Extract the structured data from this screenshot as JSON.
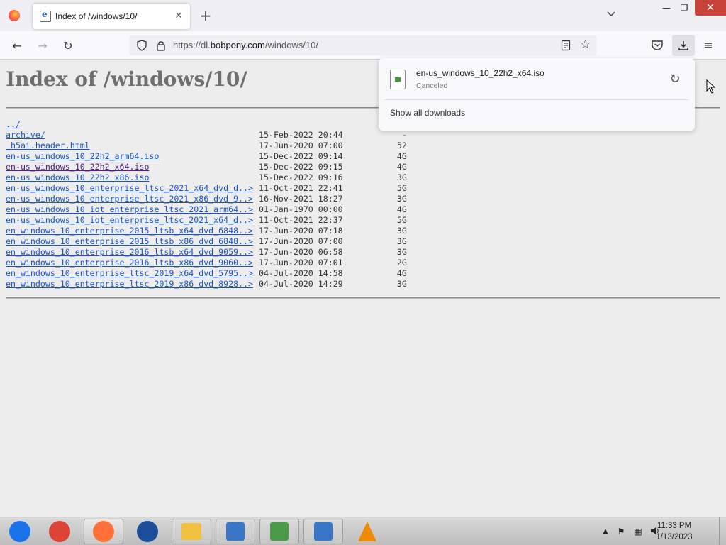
{
  "browser": {
    "tab": {
      "title": "Index of /windows/10/",
      "close": "✕"
    },
    "new_tab": "+",
    "list_tabs": "⌄",
    "window": {
      "minimize": "—",
      "restore": "❐",
      "close": "✕"
    },
    "nav": {
      "back": "←",
      "forward": "→",
      "reload": "↻"
    },
    "url": {
      "scheme": "https://dl.",
      "host": "bobpony.com",
      "path": "/windows/10/"
    },
    "star": "☆",
    "menu": "≡"
  },
  "page": {
    "heading": "Index of /windows/10/",
    "listing": [
      {
        "name": "../",
        "date": "",
        "size": "",
        "visited": false
      },
      {
        "name": "archive/",
        "date": "15-Feb-2022 20:44",
        "size": "      -",
        "visited": false
      },
      {
        "name": "_h5ai.header.html",
        "date": "17-Jun-2020 07:00",
        "size": "     52",
        "visited": false
      },
      {
        "name": "en-us_windows_10_22h2_arm64.iso",
        "date": "15-Dec-2022 09:14",
        "size": "     4G",
        "visited": false
      },
      {
        "name": "en-us_windows_10_22h2_x64.iso",
        "date": "15-Dec-2022 09:15",
        "size": "     4G",
        "visited": true
      },
      {
        "name": "en-us_windows_10_22h2_x86.iso",
        "date": "15-Dec-2022 09:16",
        "size": "     3G",
        "visited": false
      },
      {
        "name": "en-us_windows_10_enterprise_ltsc_2021_x64_dvd_d..>",
        "date": "11-Oct-2021 22:41",
        "size": "     5G",
        "visited": false
      },
      {
        "name": "en-us_windows_10_enterprise_ltsc_2021_x86_dvd_9..>",
        "date": "16-Nov-2021 18:27",
        "size": "     3G",
        "visited": false
      },
      {
        "name": "en-us_windows_10_iot_enterprise_ltsc_2021_arm64..>",
        "date": "01-Jan-1970 00:00",
        "size": "     4G",
        "visited": false
      },
      {
        "name": "en-us_windows_10_iot_enterprise_ltsc_2021_x64_d..>",
        "date": "11-Oct-2021 22:37",
        "size": "     5G",
        "visited": false
      },
      {
        "name": "en_windows_10_enterprise_2015_ltsb_x64_dvd_6848..>",
        "date": "17-Jun-2020 07:18",
        "size": "     3G",
        "visited": false
      },
      {
        "name": "en_windows_10_enterprise_2015_ltsb_x86_dvd_6848..>",
        "date": "17-Jun-2020 07:00",
        "size": "     3G",
        "visited": false
      },
      {
        "name": "en_windows_10_enterprise_2016_ltsb_x64_dvd_9059..>",
        "date": "17-Jun-2020 06:58",
        "size": "     3G",
        "visited": false
      },
      {
        "name": "en_windows_10_enterprise_2016_ltsb_x86_dvd_9060..>",
        "date": "17-Jun-2020 07:01",
        "size": "     2G",
        "visited": false
      },
      {
        "name": "en_windows_10_enterprise_ltsc_2019_x64_dvd_5795..>",
        "date": "04-Jul-2020 14:58",
        "size": "     4G",
        "visited": false
      },
      {
        "name": "en_windows_10_enterprise_ltsc_2019_x86_dvd_8928..>",
        "date": "04-Jul-2020 14:29",
        "size": "     3G",
        "visited": false
      }
    ]
  },
  "downloads_panel": {
    "item": {
      "filename": "en-us_windows_10_22h2_x64.iso",
      "status": "Canceled",
      "retry": "↻"
    },
    "show_all": "Show all downloads"
  },
  "taskbar": {
    "apps": [
      {
        "name": "chrome-os-like-icon",
        "color": "#1a73e8"
      },
      {
        "name": "chrome-icon",
        "color": "#db4437"
      },
      {
        "name": "firefox-icon",
        "color": "#ff7139"
      },
      {
        "name": "opera-like-icon",
        "color": "#1d4e9c"
      },
      {
        "name": "file-explorer-icon",
        "color": "#f0c040"
      },
      {
        "name": "network-computer-icon",
        "color": "#3a76c8"
      },
      {
        "name": "users-icon",
        "color": "#4a9a4a"
      },
      {
        "name": "remote-desktop-icon",
        "color": "#3a76c8"
      },
      {
        "name": "vlc-icon",
        "color": "#f08a00"
      }
    ],
    "tray": {
      "expand": "▲",
      "flag": "⚑",
      "network": "▦",
      "volume": "🔊"
    },
    "clock": {
      "time": "11:33 PM",
      "date": "1/13/2023"
    }
  }
}
